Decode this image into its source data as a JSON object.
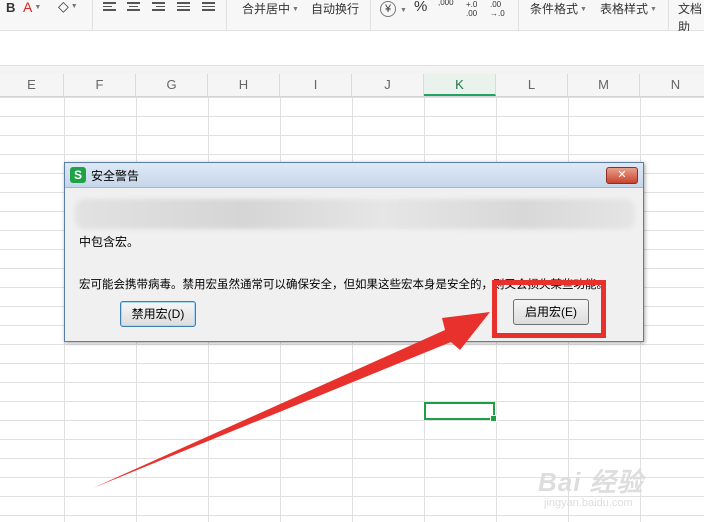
{
  "ribbon": {
    "merge_center": "合并居中",
    "wrap_text": "自动换行",
    "currency_symbol": "¥",
    "percent_symbol": "%",
    "thousand_sep_symbol": ",000",
    "increase_decimal": "+.0 .00",
    "decrease_decimal": ".00 →.0",
    "conditional_format": "条件格式",
    "table_style": "表格样式",
    "doc_assistant": "文档助",
    "font_color_letter": "A"
  },
  "grid": {
    "columns": [
      "E",
      "F",
      "G",
      "H",
      "I",
      "J",
      "K",
      "L",
      "M",
      "N"
    ],
    "active_column": "K"
  },
  "dialog": {
    "title": "安全警告",
    "app_icon_letter": "S",
    "close_glyph": "✕",
    "line1": "中包含宏。",
    "line2": "宏可能会携带病毒。禁用宏虽然通常可以确保安全，但如果这些宏本身是安全的，则又会损失某些功能。",
    "disable_button": "禁用宏(D)",
    "enable_button": "启用宏(E)"
  },
  "annotation": {
    "color": "#e8312c"
  },
  "watermark": {
    "main": "Bai 经验",
    "sub": "jingyan.baidu.com"
  }
}
